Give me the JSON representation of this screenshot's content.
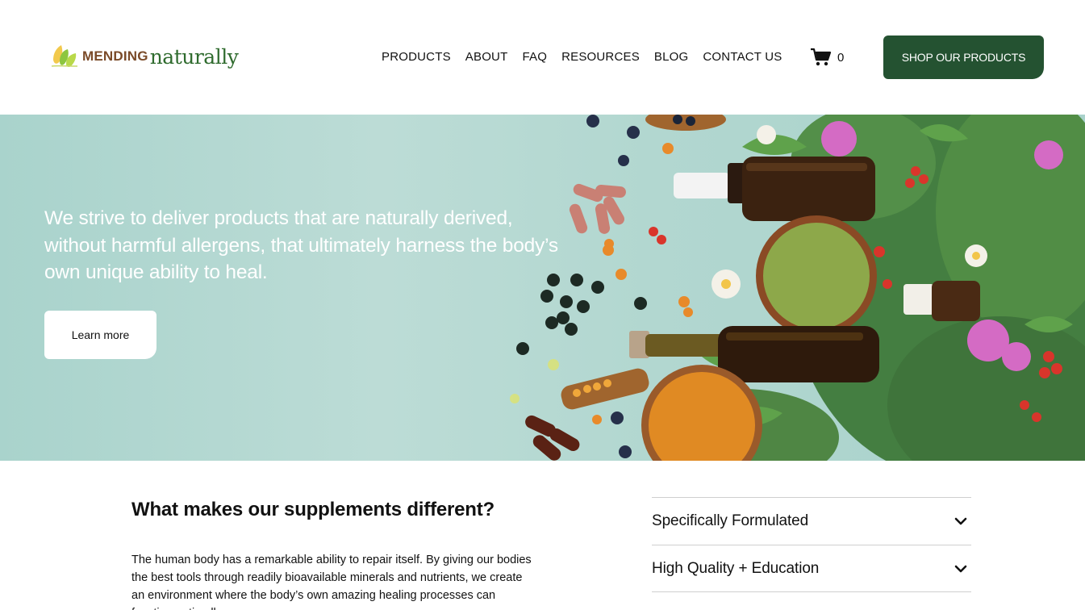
{
  "header": {
    "logo": {
      "bold": "MENDING",
      "script": "naturally"
    },
    "nav": [
      "PRODUCTS",
      "ABOUT",
      "FAQ",
      "RESOURCES",
      "BLOG",
      "CONTACT US"
    ],
    "cart_count": "0",
    "shop_button": "SHOP OUR PRODUCTS"
  },
  "hero": {
    "headline": "We strive to  deliver products that are naturally derived, without harmful allergens, that ultimately harness the body’s own unique ability to heal.",
    "cta": "Learn more"
  },
  "section": {
    "title": "What makes our supplements different?",
    "body": "The human body has a remarkable ability to repair itself.  By giving our bodies the best tools through readily bioavailable minerals and nutrients, we create an environment where the body’s own amazing healing processes can function optimally."
  },
  "accordion": [
    {
      "label": "Specifically Formulated"
    },
    {
      "label": "High Quality + Education"
    }
  ],
  "colors": {
    "brand_green": "#245231",
    "hero_bg": "#b2d7d0",
    "logo_brown": "#7a4a28",
    "logo_green": "#2f6b2e"
  },
  "icons": [
    "leaf-logo-icon",
    "cart-icon",
    "chevron-down-icon",
    "hero-herbs-image"
  ]
}
